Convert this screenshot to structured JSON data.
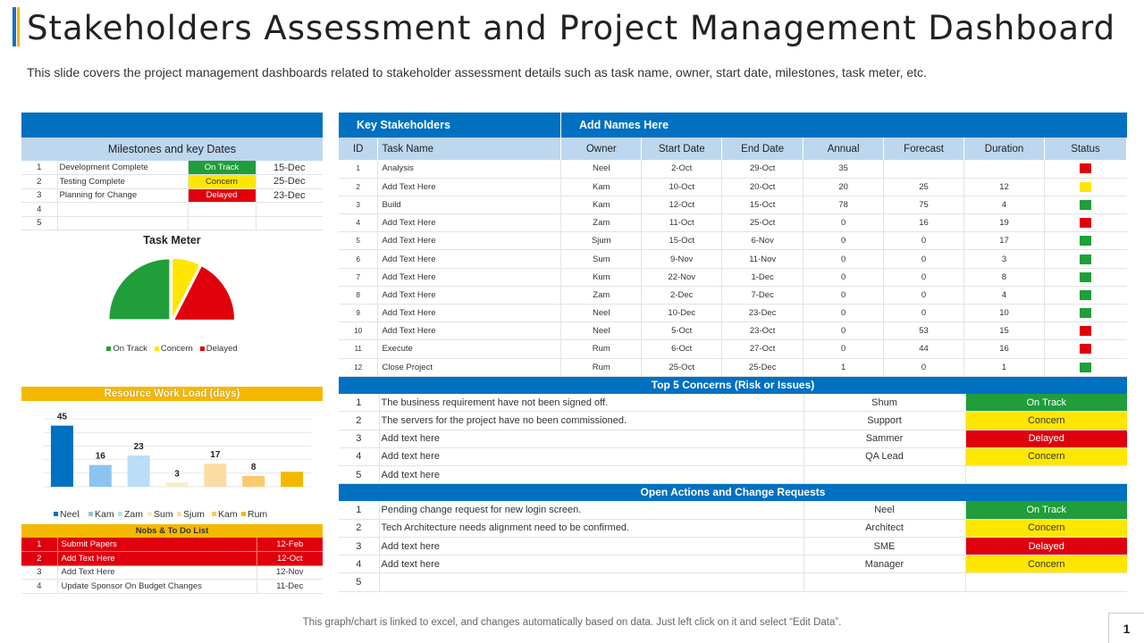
{
  "header": {
    "title": "Stakeholders Assessment and Project Management Dashboard",
    "subtitle": "This slide covers the project management dashboards related to stakeholder assessment details such as task name, owner, start date, milestones, task meter, etc."
  },
  "colors": {
    "blue": "#0070c0",
    "light_blue": "#bdd7ee",
    "green": "#1f9e3a",
    "yellow": "#ffe600",
    "red": "#e0000d",
    "orange": "#f5b800"
  },
  "milestones": {
    "title": "Milestones and key Dates",
    "rows": [
      {
        "num": "1",
        "task": "Development Complete",
        "status": "On Track",
        "color": "green",
        "date": "15-Dec"
      },
      {
        "num": "2",
        "task": "Testing Complete",
        "status": "Concern",
        "color": "yellow",
        "date": "25-Dec"
      },
      {
        "num": "3",
        "task": "Planning  for Change",
        "status": "Delayed",
        "color": "red",
        "date": "23-Dec"
      },
      {
        "num": "4",
        "task": "",
        "status": "",
        "color": "",
        "date": ""
      },
      {
        "num": "5",
        "task": "",
        "status": "",
        "color": "",
        "date": ""
      }
    ]
  },
  "task_meter": {
    "title": "Task Meter",
    "legend": [
      "On Track",
      "Concern",
      "Delayed"
    ]
  },
  "resource": {
    "title": "Resource Work Load (days)"
  },
  "chart_data": [
    {
      "type": "pie",
      "title": "Task Meter",
      "categories": [
        "On Track",
        "Concern",
        "Delayed"
      ],
      "values": [
        50,
        15,
        35
      ],
      "colors": [
        "#1f9e3a",
        "#ffe600",
        "#e0000d"
      ],
      "legend": "bottom"
    },
    {
      "type": "bar",
      "title": "Resource Work Load (days)",
      "categories": [
        "Neel",
        "Kam",
        "Zam",
        "Sum",
        "Sjum",
        "Kam",
        "Rum"
      ],
      "values": [
        45,
        16,
        23,
        3,
        17,
        8,
        null
      ],
      "colors": [
        "#0070c0",
        "#8cc4f0",
        "#bcdcf7",
        "#fbecc8",
        "#fbdca3",
        "#fac96b",
        "#f5b800"
      ],
      "legend": "bottom",
      "grid": true
    }
  ],
  "todo": {
    "title": "Nobs & To Do List",
    "rows": [
      {
        "num": "1",
        "item": "Submit Papers",
        "date": "12-Feb",
        "highlight": true
      },
      {
        "num": "2",
        "item": "Add Text Here",
        "date": "12-Oct",
        "highlight": true
      },
      {
        "num": "3",
        "item": "Add Text Here",
        "date": "12-Nov",
        "highlight": false
      },
      {
        "num": "4",
        "item": "Update Sponsor On Budget Changes",
        "date": "11-Dec",
        "highlight": false
      }
    ]
  },
  "stakeholders": {
    "head_left": "Key Stakeholders",
    "head_right": "Add  Names Here",
    "columns": [
      "ID",
      "Task Name",
      "Owner",
      "Start Date",
      "End Date",
      "Annual",
      "Forecast",
      "Duration",
      "Status"
    ],
    "rows": [
      {
        "id": "1",
        "task": "Analysis",
        "owner": "Neel",
        "start": "2-Oct",
        "end": "29-Oct",
        "annual": "35",
        "forecast": "",
        "duration": "",
        "status": "red"
      },
      {
        "id": "2",
        "task": "Add Text Here",
        "owner": "Kam",
        "start": "10-Oct",
        "end": "20-Oct",
        "annual": "20",
        "forecast": "25",
        "duration": "12",
        "status": "yellow"
      },
      {
        "id": "3",
        "task": "Build",
        "owner": "Kam",
        "start": "12-Oct",
        "end": "15-Oct",
        "annual": "78",
        "forecast": "75",
        "duration": "4",
        "status": "green"
      },
      {
        "id": "4",
        "task": "Add Text Here",
        "owner": "Zam",
        "start": "11-Oct",
        "end": "25-Oct",
        "annual": "0",
        "forecast": "16",
        "duration": "19",
        "status": "red"
      },
      {
        "id": "5",
        "task": "Add Text Here",
        "owner": "Sjum",
        "start": "15-Oct",
        "end": "6-Nov",
        "annual": "0",
        "forecast": "0",
        "duration": "17",
        "status": "green"
      },
      {
        "id": "6",
        "task": "Add Text Here",
        "owner": "Sum",
        "start": "9-Nov",
        "end": "11-Nov",
        "annual": "0",
        "forecast": "0",
        "duration": "3",
        "status": "green"
      },
      {
        "id": "7",
        "task": "Add Text Here",
        "owner": "Kum",
        "start": "22-Nov",
        "end": "1-Dec",
        "annual": "0",
        "forecast": "0",
        "duration": "8",
        "status": "green"
      },
      {
        "id": "8",
        "task": "Add Text Here",
        "owner": "Zam",
        "start": "2-Dec",
        "end": "7-Dec",
        "annual": "0",
        "forecast": "0",
        "duration": "4",
        "status": "green"
      },
      {
        "id": "9",
        "task": "Add Text Here",
        "owner": "Neel",
        "start": "10-Dec",
        "end": "23-Dec",
        "annual": "0",
        "forecast": "0",
        "duration": "10",
        "status": "green"
      },
      {
        "id": "10",
        "task": "Add Text Here",
        "owner": "Neel",
        "start": "5-Oct",
        "end": "23-Oct",
        "annual": "0",
        "forecast": "53",
        "duration": "15",
        "status": "red"
      },
      {
        "id": "11",
        "task": "Execute",
        "owner": "Rum",
        "start": "6-Oct",
        "end": "27-Oct",
        "annual": "0",
        "forecast": "44",
        "duration": "16",
        "status": "red"
      },
      {
        "id": "12",
        "task": "Close Project",
        "owner": "Rum",
        "start": "25-Oct",
        "end": "25-Dec",
        "annual": "1",
        "forecast": "0",
        "duration": "1",
        "status": "green"
      }
    ]
  },
  "concerns": {
    "title": "Top 5 Concerns (Risk or Issues)",
    "rows": [
      {
        "num": "1",
        "desc": "The business requirement have not been signed off.",
        "owner": "Shum",
        "status": "On Track",
        "color": "green"
      },
      {
        "num": "2",
        "desc": "The servers for the project have no been commissioned.",
        "owner": "Support",
        "status": "Concern",
        "color": "yellow"
      },
      {
        "num": "3",
        "desc": "Add text here",
        "owner": "Sammer",
        "status": "Delayed",
        "color": "red"
      },
      {
        "num": "4",
        "desc": "Add text here",
        "owner": "QA Lead",
        "status": "Concern",
        "color": "yellow"
      },
      {
        "num": "5",
        "desc": "Add text here",
        "owner": "",
        "status": "",
        "color": ""
      }
    ]
  },
  "actions": {
    "title": "Open Actions and Change Requests",
    "rows": [
      {
        "num": "1",
        "desc": "Pending change request for new login screen.",
        "owner": "Neel",
        "status": "On Track",
        "color": "green"
      },
      {
        "num": "2",
        "desc": "Tech Architecture needs alignment need to be confirmed.",
        "owner": "Architect",
        "status": "Concern",
        "color": "yellow"
      },
      {
        "num": "3",
        "desc": "Add text here",
        "owner": "SME",
        "status": "Delayed",
        "color": "red"
      },
      {
        "num": "4",
        "desc": "Add text here",
        "owner": "Manager",
        "status": "Concern",
        "color": "yellow"
      },
      {
        "num": "5",
        "desc": "",
        "owner": "",
        "status": "",
        "color": ""
      }
    ]
  },
  "footer": {
    "note": "This graph/chart is linked to excel,  and changes automatically based on data. Just left click on it and select “Edit Data”.",
    "page": "1"
  }
}
